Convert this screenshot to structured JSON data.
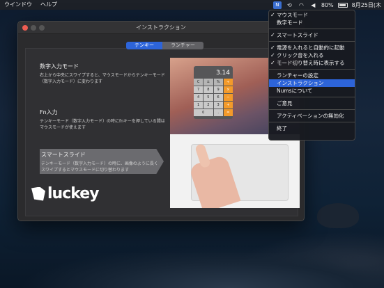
{
  "menubar": {
    "left_items": [
      "ウインドウ",
      "ヘルプ"
    ],
    "battery": "80%",
    "date": "8月25日(木"
  },
  "window": {
    "title": "インストラクション",
    "tabs": [
      {
        "label": "テンキー",
        "active": true
      },
      {
        "label": "ランチャー",
        "active": false
      }
    ],
    "sections": [
      {
        "heading": "数字入力モード",
        "text": "右上から中央にスワイプすると、マウスモードからテンキーモード（数字入力モード）に変わります"
      },
      {
        "heading": "Fn入力",
        "text": "テンキーモード（数字入力モード）の時にfnキーを押している間はマウスモードが使えます"
      },
      {
        "heading": "スマートスライド",
        "text": "テンキーモード（数字入力モード）の時に、画像のように長くスワイプするとマウスモードに切り替わります"
      }
    ],
    "logo_text": "luckey",
    "calc_display": "3.14",
    "calc_keys": [
      "C",
      "±",
      "%",
      "÷",
      "7",
      "8",
      "9",
      "×",
      "4",
      "5",
      "6",
      "−",
      "1",
      "2",
      "3",
      "+",
      "0",
      ".",
      "="
    ]
  },
  "dropdown": {
    "group1": [
      {
        "label": "マウスモード",
        "checked": true
      },
      {
        "label": "数字モード",
        "checked": false
      }
    ],
    "group2": [
      {
        "label": "スマートスライド",
        "checked": true
      }
    ],
    "group3": [
      {
        "label": "電源を入れると自動的に起動",
        "checked": true
      },
      {
        "label": "クリック音を入れる",
        "checked": true
      },
      {
        "label": "モード切り替え時に表示する",
        "checked": true
      }
    ],
    "group4": [
      {
        "label": "ランチャーの設定",
        "highlighted": false
      },
      {
        "label": "インストラクション",
        "highlighted": true
      },
      {
        "label": "Numsについて",
        "highlighted": false
      }
    ],
    "group5": [
      {
        "label": "ご意見"
      }
    ],
    "group6": [
      {
        "label": "アクティベーションの無効化"
      }
    ],
    "group7": [
      {
        "label": "終了"
      }
    ]
  }
}
